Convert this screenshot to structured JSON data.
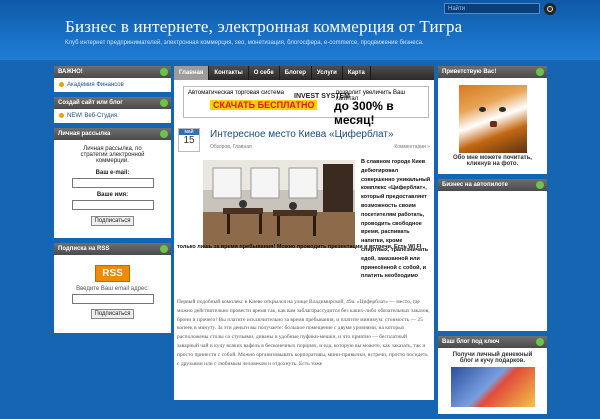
{
  "header": {
    "title": "Бизнес в интернете, электронная коммерция от Тигра",
    "description": "Клуб интернет предпринимателей, электронная коммерция, seo, монетизация, блогосфера, e-commerce, продвижение бизнеса.",
    "search_placeholder": "Найти"
  },
  "left": {
    "important": {
      "title": "ВАЖНО!",
      "link": "Академия Финансов"
    },
    "create_blog": {
      "title": "Создай сайт или блог",
      "link": "NEW! Веб-Студия."
    },
    "newsletter": {
      "title": "Личная рассылка",
      "intro": "Личная рассылка, по стратегии электронной коммерции.",
      "email_label": "Ваш e-mail:",
      "name_label": "Ваше имя:",
      "submit": "Подписаться"
    },
    "rss": {
      "title": "Подписка на RSS",
      "badge": "RSS",
      "email_label": "Введите Ваш email адрес:",
      "submit": "Подписаться"
    }
  },
  "nav": [
    "Главная",
    "Контакты",
    "О себе",
    "Блогер",
    "Услуги",
    "Карта"
  ],
  "banner": {
    "line1": "Автоматическая торговая система",
    "cta": "СКАЧАТЬ БЕСПЛАТНО",
    "brand": "INVEST SYSTEM",
    "line2": "позволит увеличить  Ваш капитал",
    "big": "до 300% в месяц!"
  },
  "post": {
    "month": "май",
    "day": "15",
    "title": "Интересное место Киева «Циферблат»",
    "meta": "Обзоров, Главная",
    "comments": "Комментарии »",
    "side_text": "В славном городе Киев дебютировал совершенно уникальный комплекс «Циферблат», который предоставляет возможность своим посетителям работать, проводить свободное время, распивать напитки, кроме спиртных, трапезничать едой, заказанной или принесённой с собой, и платить необходимо",
    "full_text": "только лишь за время пребывания! Можно проводить презентации и встречи. Есть WI FI",
    "para": "Первый подобный комплекс в Киеве открылся на улице Владимирской, 49а. «Циферблат» — место, где можно действительно провести время так, как вам заблагорассудится без каких-либо обязательных заказов, брони и прочего! Вы платите исключительно за время пребывания, и платите минимум: стоимость — 25 копеек в минуту. За эти деньги вы получаете: большое помещение с двумя уровнями, на которых расположены столы со стульями, диваны и удобные пуфики-мешки, и что приятно — бесплатный завариый чай и кучу всяких вафель в бесконечных порциях, и еда, которую вы можете, как заказать, так и просто принести с собой. Можно организовывать корпоративы, мини-привычки, встречи, просто посидеть с друзьями или с любимым человеком и отдохнуть. Есть тоже"
  },
  "right": {
    "welcome": {
      "title": "Приветствую Вас!",
      "caption": "Обо мне можете почитать, кликнув на фото."
    },
    "auto": {
      "title": "Бизнес на автопилоте"
    },
    "blog": {
      "title": "Ваш блог под ключ",
      "caption": "Получи личный денежный блог и кучу подарков."
    }
  }
}
